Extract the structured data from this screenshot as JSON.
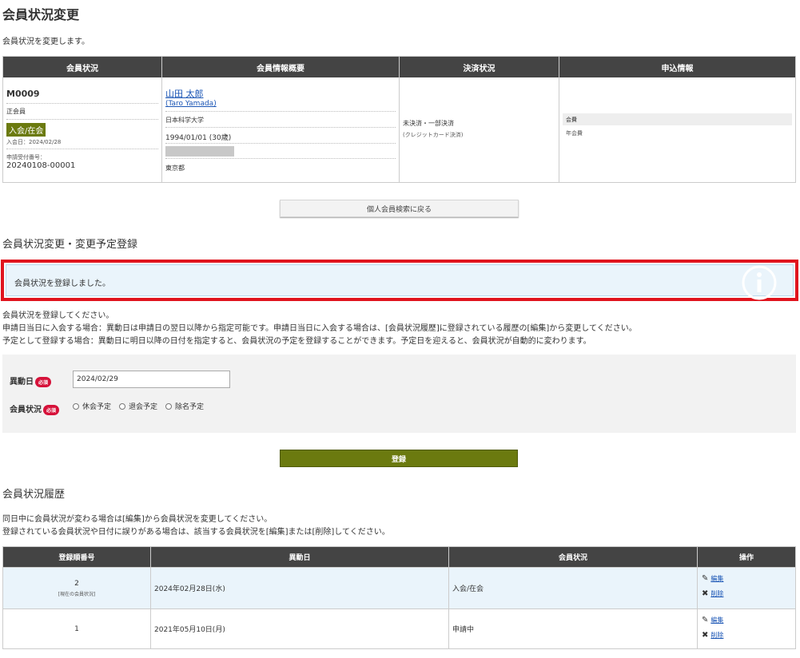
{
  "page": {
    "title": "会員状況変更",
    "description": "会員状況を変更します。"
  },
  "summary": {
    "headers": [
      "会員状況",
      "会員情報概要",
      "決済状況",
      "申込情報"
    ],
    "member_id": "M0009",
    "member_type": "正会員",
    "status_badge": "入会/在会",
    "join_date": "入会日：2024/02/28",
    "reg_label": "申請受付番号：",
    "reg_no": "20240108-00001",
    "name": "山田 太郎",
    "name_en": "(Taro Yamada)",
    "university": "日本科学大学",
    "birth": "1994/01/01 (30歳)",
    "prefecture": "東京都",
    "payment_status": "未決済・一部決済",
    "payment_method": "(クレジットカード決済)",
    "fee_label": "会費",
    "fee_sub": "年会費"
  },
  "back_button": "個人会員検索に戻る",
  "change_section": {
    "title": "会員状況変更・変更予定登録",
    "alert": "会員状況を登録しました。",
    "notes": [
      "会員状況を登録してください。",
      "申請日当日に入会する場合：異動日は申請日の翌日以降から指定可能です。申請日当日に入会する場合は、[会員状況履歴]に登録されている履歴の[編集]から変更してください。",
      "予定として登録する場合：異動日に明日以降の日付を指定すると、会員状況の予定を登録することができます。予定日を迎えると、会員状況が自動的に変わります。"
    ]
  },
  "form": {
    "date_label": "異動日",
    "required": "必須",
    "date_value": "2024/02/29",
    "status_label": "会員状況",
    "radios": [
      "休会予定",
      "退会予定",
      "除名予定"
    ],
    "submit": "登録"
  },
  "history": {
    "title": "会員状況履歴",
    "notes": [
      "同日中に会員状況が変わる場合は[編集]から会員状況を変更してください。",
      "登録されている会員状況や日付に誤りがある場合は、該当する会員状況を[編集]または[削除]してください。"
    ],
    "headers": [
      "登録順番号",
      "異動日",
      "会員状況",
      "操作"
    ],
    "rows": [
      {
        "no": "2",
        "sub": "[現在の会員状況]",
        "date": "2024年02月28日(水)",
        "status": "入会/在会",
        "edit": "編集",
        "delete": "削除"
      },
      {
        "no": "1",
        "sub": "",
        "date": "2021年05月10日(月)",
        "status": "申請中",
        "edit": "編集",
        "delete": "削除"
      }
    ]
  }
}
